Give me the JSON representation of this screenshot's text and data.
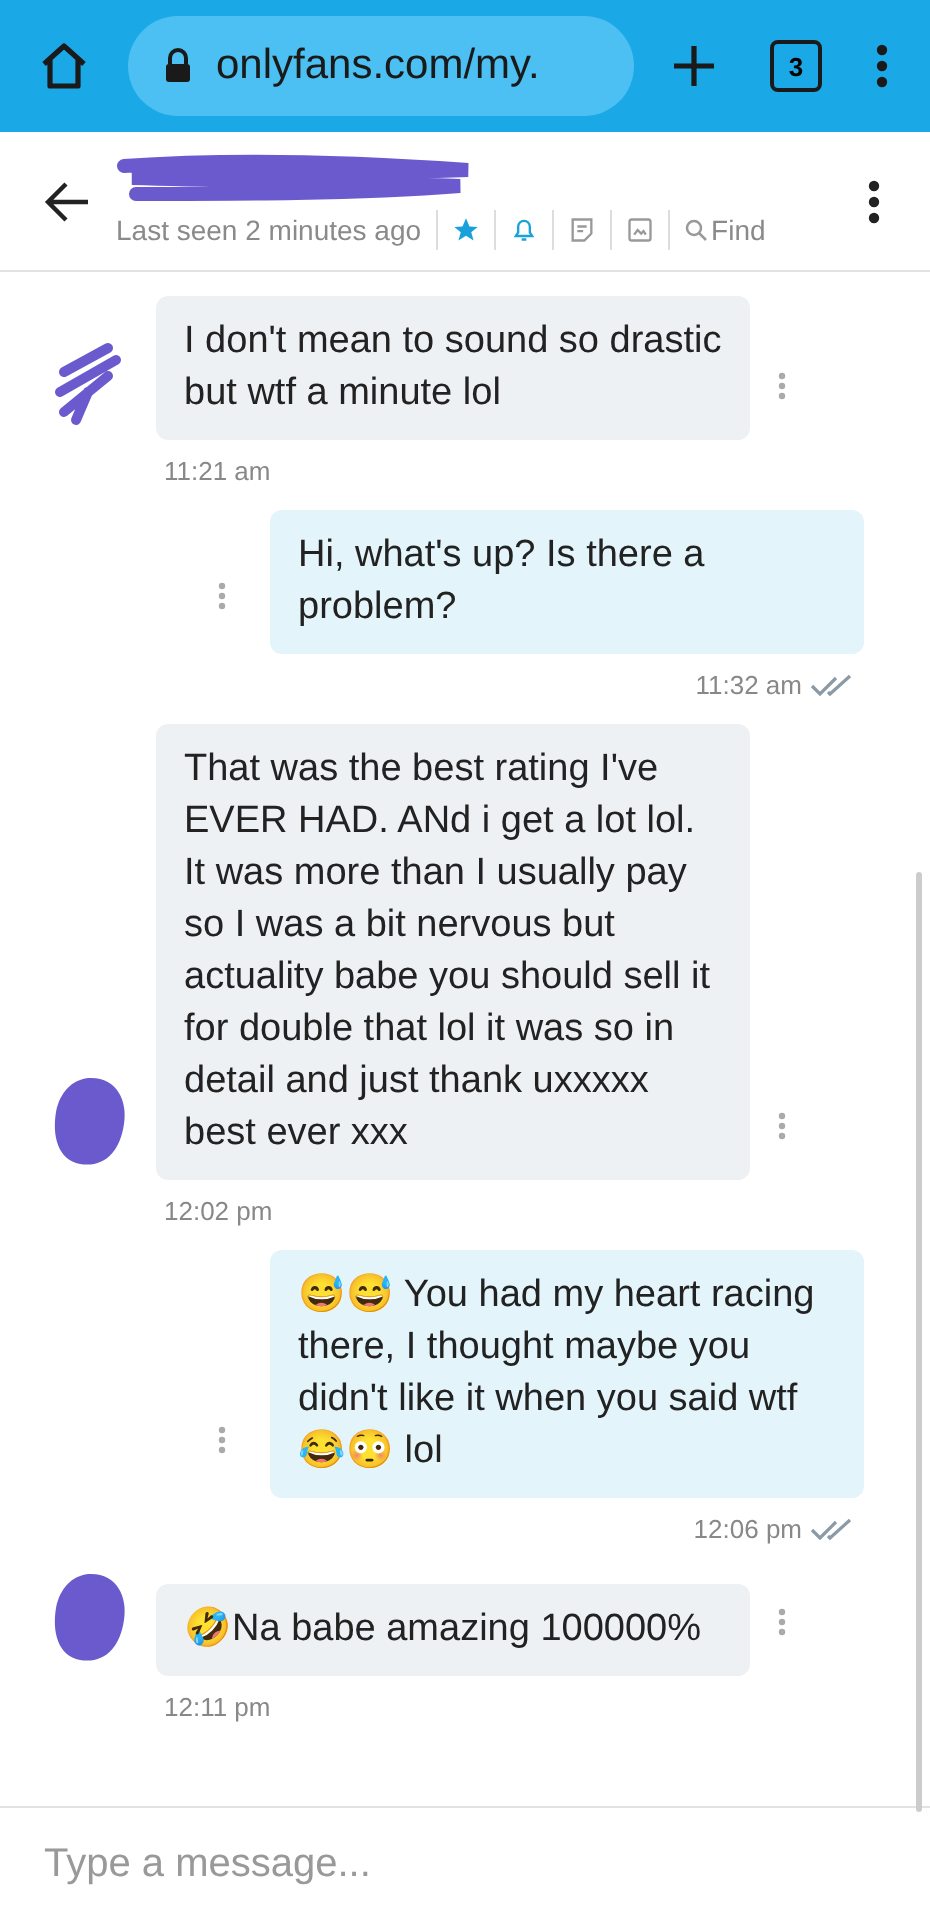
{
  "browser": {
    "url": "onlyfans.com/my.",
    "tab_count": "3"
  },
  "chat_header": {
    "status": "Last seen 2 minutes ago",
    "find_label": "Find"
  },
  "messages": [
    {
      "kind": "incoming",
      "text": "I don't mean to sound so drastic but wtf a minute lol",
      "time": "11:21 am",
      "avatar": false
    },
    {
      "kind": "outgoing",
      "text": "Hi, what's up? Is there a problem?",
      "time": "11:32 am",
      "read": true
    },
    {
      "kind": "incoming",
      "text": "That was the best rating I've EVER HAD. ANd i get a lot lol. It was more than I usually pay so I was a bit nervous but actuality babe you should sell it for double that lol it was so in detail and just thank uxxxxx best ever xxx",
      "time": "12:02 pm",
      "avatar": true
    },
    {
      "kind": "outgoing",
      "text": "😅😅 You had my heart racing there, I thought maybe you didn't like it when you said wtf 😂😳 lol",
      "time": "12:06 pm",
      "read": true
    },
    {
      "kind": "incoming",
      "text": "🤣Na babe amazing 100000%",
      "time": "12:11 pm",
      "avatar": true
    }
  ],
  "composer": {
    "placeholder": "Type a message..."
  }
}
